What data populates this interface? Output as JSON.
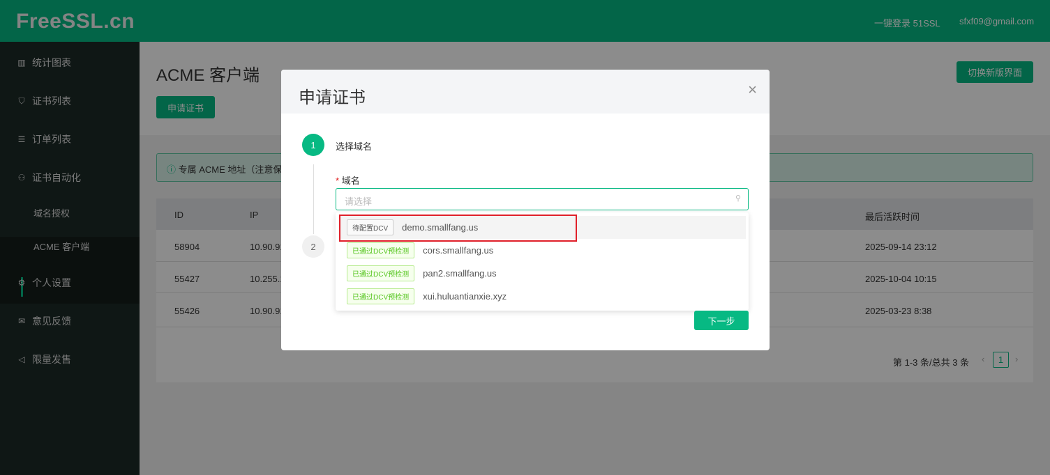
{
  "header": {
    "logo": "FreeSSL.cn",
    "login_51ssl": "一键登录 51SSL",
    "user_email": "sfxf09@gmail.com"
  },
  "sidebar": {
    "items": [
      {
        "label": "统计图表",
        "icon": "bar-chart-icon"
      },
      {
        "label": "证书列表",
        "icon": "shield-icon"
      },
      {
        "label": "订单列表",
        "icon": "list-icon"
      },
      {
        "label": "证书自动化",
        "icon": "sitemap-icon"
      },
      {
        "label": "个人设置",
        "icon": "gear-icon"
      },
      {
        "label": "意见反馈",
        "icon": "mail-icon"
      },
      {
        "label": "限量发售",
        "icon": "megaphone-icon"
      }
    ],
    "sub_items": [
      {
        "label": "域名授权"
      },
      {
        "label": "ACME 客户端",
        "active": true
      }
    ]
  },
  "page": {
    "title": "ACME 客户端",
    "apply_button": "申请证书",
    "switch_button": "切换新版界面",
    "alert": "专属 ACME 地址（注意保"
  },
  "table": {
    "columns": [
      "ID",
      "IP",
      "最后活跃时间"
    ],
    "rows": [
      {
        "id": "58904",
        "ip": "10.90.91",
        "last_active": "2025-09-14 23:12"
      },
      {
        "id": "55427",
        "ip": "10.255.1",
        "last_active": "2025-10-04 10:15"
      },
      {
        "id": "55426",
        "ip": "10.90.91",
        "last_active": "2025-03-23 8:38"
      }
    ]
  },
  "pagination": {
    "summary": "第 1-3 条/总共 3 条",
    "current_page": "1",
    "prev": "‹",
    "next": "›"
  },
  "modal": {
    "title": "申请证书",
    "close": "×",
    "steps": [
      {
        "number": "1",
        "label": "选择域名"
      },
      {
        "number": "2"
      }
    ],
    "field_label": "域名",
    "required_mark": "*",
    "placeholder": "请选择",
    "options": [
      {
        "tag": "待配置DCV",
        "domain": "demo.smallfang.us",
        "status": "pending"
      },
      {
        "tag": "已通过DCV预检测",
        "domain": "cors.smallfang.us",
        "status": "passed"
      },
      {
        "tag": "已通过DCV预检测",
        "domain": "pan2.smallfang.us",
        "status": "passed"
      },
      {
        "tag": "已通过DCV预检测",
        "domain": "xui.huluantianxie.xyz",
        "status": "passed"
      }
    ],
    "next_button": "下一步"
  }
}
